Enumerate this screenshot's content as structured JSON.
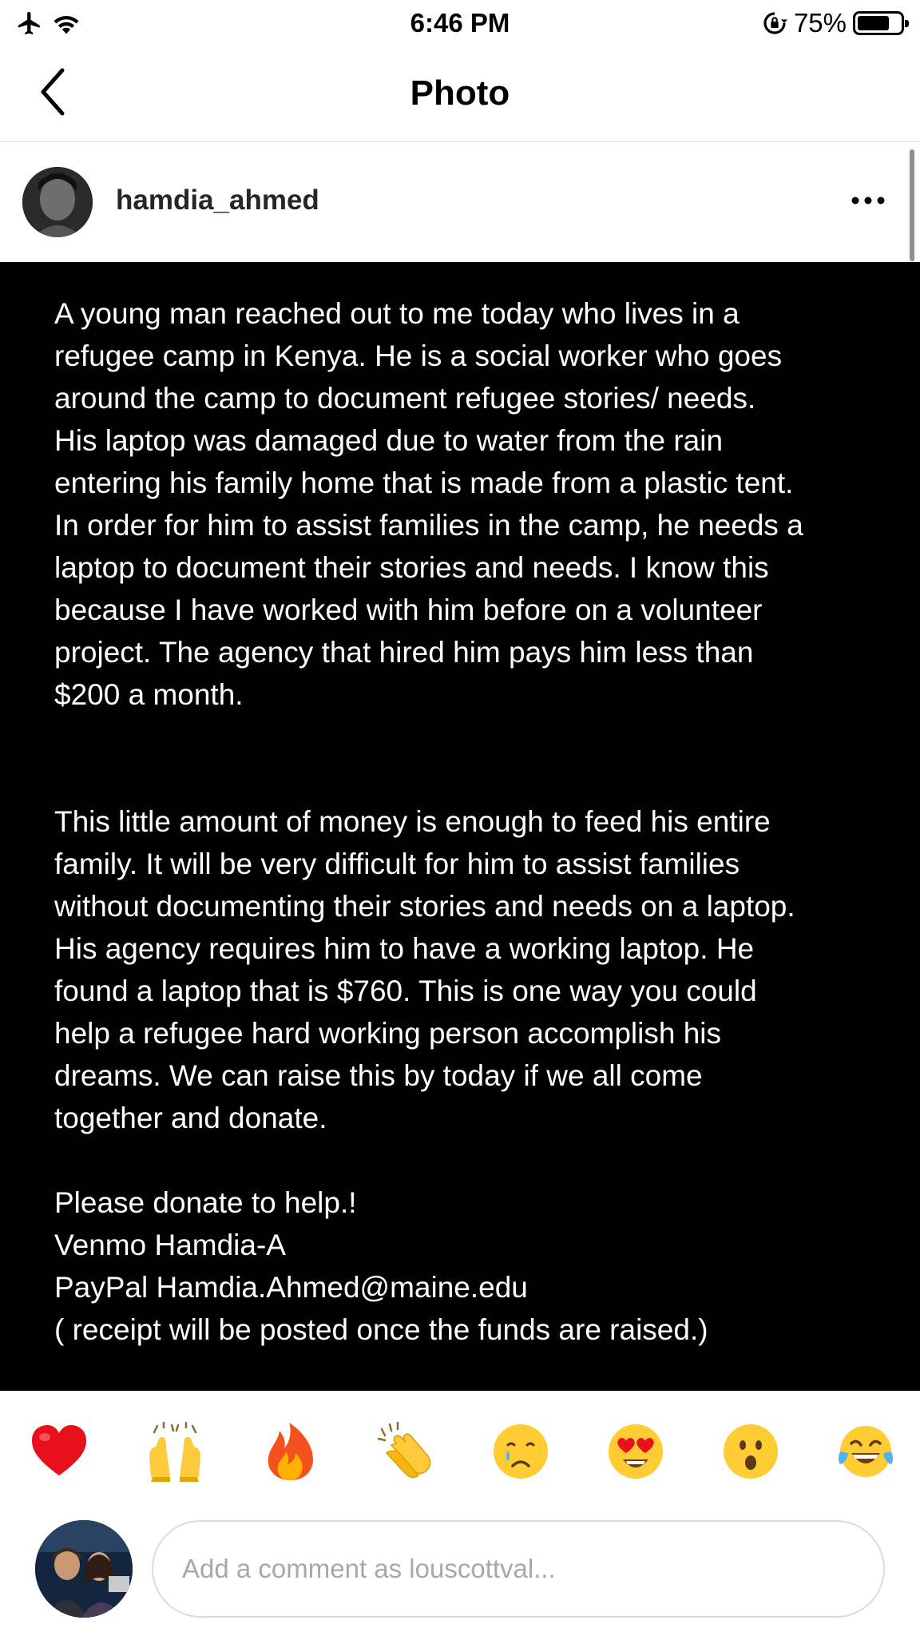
{
  "status_bar": {
    "time": "6:46 PM",
    "battery_percent": "75%",
    "battery_level": 0.75,
    "icons": [
      "airplane-icon",
      "wifi-icon",
      "orientation-lock-icon",
      "battery-icon"
    ]
  },
  "nav": {
    "title": "Photo",
    "back_icon": "chevron-left-icon"
  },
  "post": {
    "username": "hamdia_ahmed",
    "more_icon": "more-horizontal-icon",
    "image_text": {
      "paragraph_1": "A young man reached out to me today who lives in a\nrefugee camp in Kenya. He is a social worker who goes\naround the camp to document refugee stories/ needs.\nHis laptop was damaged due to water from the rain\nentering his family home that is made from a plastic tent.\nIn order for him to assist families in the camp, he needs a\nlaptop to document their stories and needs. I know this\nbecause I have worked with him before on a volunteer\nproject. The agency that hired him pays him less than\n$200 a month.",
      "paragraph_2": "This little amount of money is enough to feed his entire\nfamily. It will be very difficult for him to assist families\nwithout documenting their stories and needs on a laptop.\nHis agency requires him to have a working laptop.  He\nfound a laptop that is $760. This  is one way you could\nhelp a refugee hard working person accomplish his\ndreams.  We can raise this by today if we all come\ntogether and donate.",
      "paragraph_3": "Please donate to help.!\nVenmo Hamdia-A\nPayPal Hamdia.Ahmed@maine.edu\n( receipt will be posted once the funds are raised.)"
    }
  },
  "reactions": [
    {
      "name": "red-heart-icon"
    },
    {
      "name": "raising-hands-icon"
    },
    {
      "name": "fire-icon"
    },
    {
      "name": "clapping-hands-icon"
    },
    {
      "name": "crying-face-icon"
    },
    {
      "name": "heart-eyes-face-icon"
    },
    {
      "name": "surprised-face-icon"
    },
    {
      "name": "tears-of-joy-face-icon"
    }
  ],
  "comment": {
    "placeholder": "Add a comment as louscottval..."
  }
}
